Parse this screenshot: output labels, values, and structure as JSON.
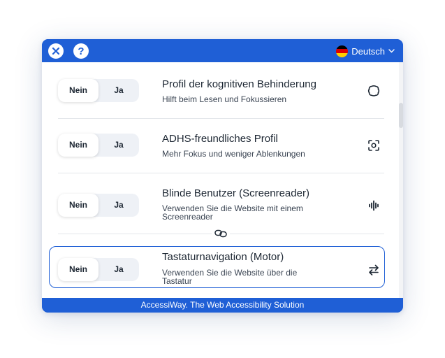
{
  "header": {
    "close_icon": "close-icon",
    "help_label": "?",
    "language": "Deutsch",
    "flag_colors": [
      "#000000",
      "#dd0000",
      "#ffce00"
    ],
    "accent": "#1f5fd6"
  },
  "profiles": [
    {
      "title": "Profil der kognitiven Behinderung",
      "desc_lines": [
        "Hilft beim Lesen und Fokussieren"
      ],
      "no": "Nein",
      "yes": "Ja",
      "icon": "brain-outline-icon"
    },
    {
      "title": "ADHS-freundliches Profil",
      "desc_lines": [
        "Mehr Fokus und weniger Ablenkungen"
      ],
      "no": "Nein",
      "yes": "Ja",
      "icon": "focus-target-icon"
    },
    {
      "title": "Blinde Benutzer (Screenreader)",
      "desc_lines": [
        "Verwenden Sie die Website mit einem",
        "Screenreader"
      ],
      "no": "Nein",
      "yes": "Ja",
      "icon": "audio-wave-icon"
    },
    {
      "title": "Tastaturnavigation (Motor)",
      "desc_lines": [
        "Verwenden Sie die Website über die",
        "Tastatur"
      ],
      "no": "Nein",
      "yes": "Ja",
      "icon": "swap-arrows-icon"
    }
  ],
  "footer": {
    "text": "AccessiWay. The Web Accessibility Solution"
  }
}
